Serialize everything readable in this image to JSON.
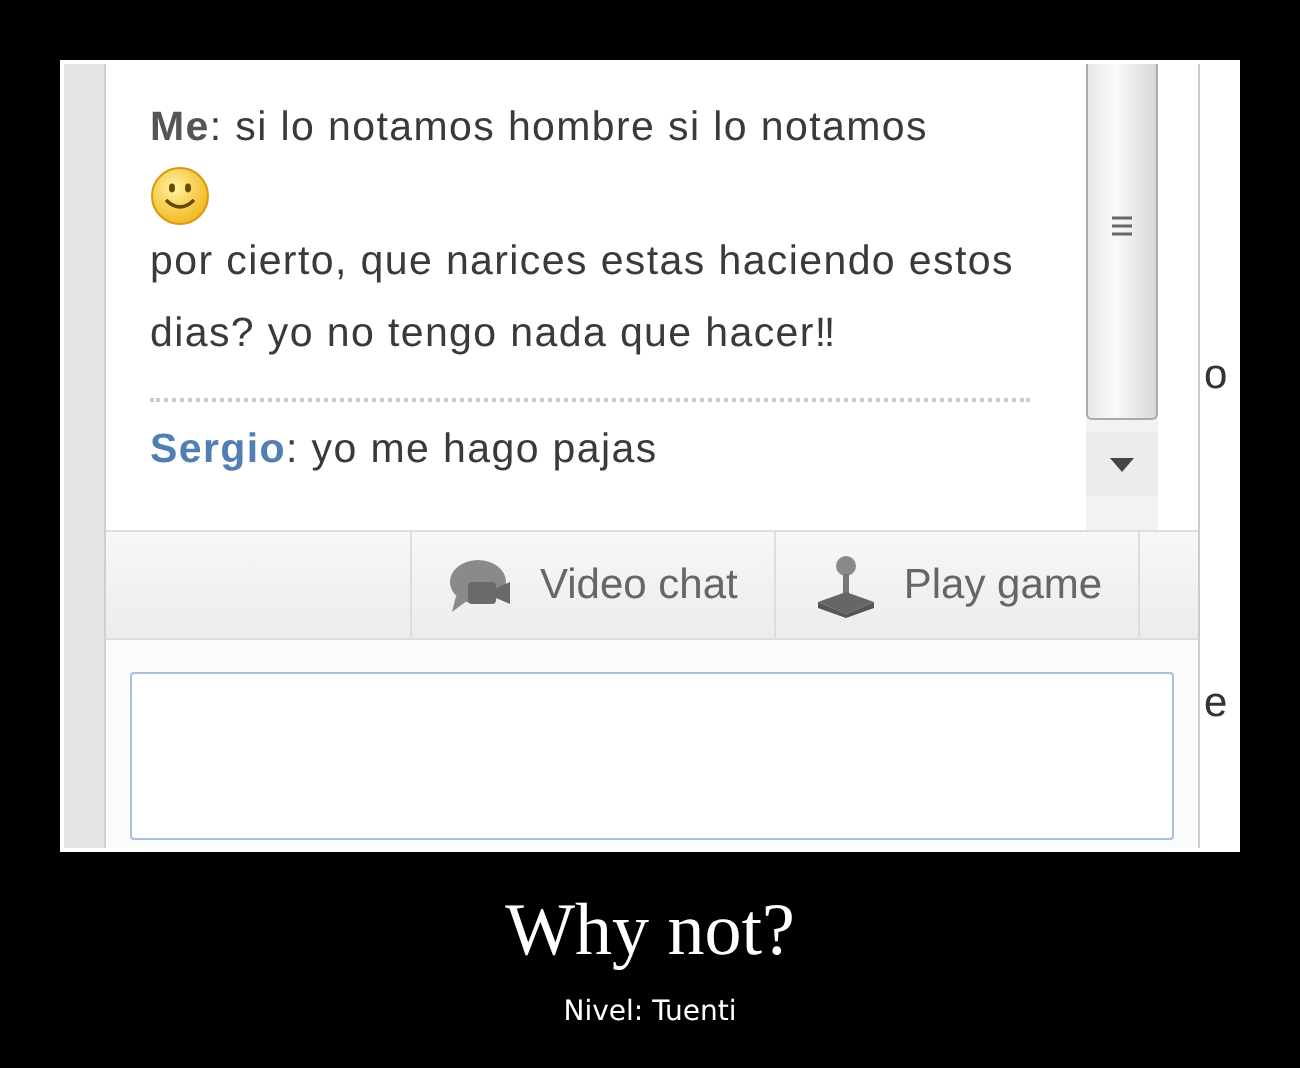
{
  "chat": {
    "messages": [
      {
        "sender": "Me",
        "kind": "self",
        "parts": [
          {
            "kind": "text",
            "text": ": si lo notamos hombre si lo notamos"
          },
          {
            "kind": "emoji"
          },
          {
            "kind": "text",
            "text": "por cierto, que narices estas haciendo estos dias? yo no tengo nada que hacer‼"
          }
        ]
      },
      {
        "sender": "Sergio",
        "kind": "contact",
        "parts": [
          {
            "kind": "text",
            "text": ": yo me hago pajas"
          }
        ]
      }
    ],
    "actions": [
      {
        "label": "Video chat",
        "kind": "video"
      },
      {
        "label": "Play game",
        "kind": "game"
      }
    ],
    "side_fragments": [
      "o",
      "e"
    ]
  },
  "caption": {
    "title": "Why not?",
    "subtitle": "Nivel: Tuenti"
  }
}
